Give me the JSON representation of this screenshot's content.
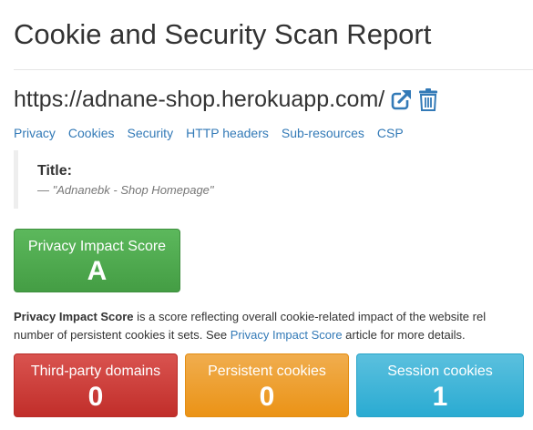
{
  "page": {
    "title": "Cookie and Security Scan Report"
  },
  "site": {
    "url": "https://adnane-shop.herokuapp.com/"
  },
  "icons": {
    "open": "external-link-icon",
    "delete": "trash-icon"
  },
  "colors": {
    "link": "#337ab7",
    "success": "#5cb85c",
    "danger": "#d9534f",
    "warning": "#f0ad4e",
    "info": "#5bc0de"
  },
  "nav": {
    "links": [
      "Privacy",
      "Cookies",
      "Security",
      "HTTP headers",
      "Sub-resources",
      "CSP"
    ]
  },
  "title_block": {
    "heading": "Title:",
    "value": "— \"Adnanebk - Shop Homepage\""
  },
  "privacy_score": {
    "label": "Privacy Impact Score",
    "grade": "A"
  },
  "explanation": {
    "term": "Privacy Impact Score",
    "text1": " is a score reflecting overall cookie-related impact of the website rel",
    "text2": "number of persistent cookies it sets. See ",
    "link": "Privacy Impact Score",
    "text3": " article for more details."
  },
  "stats": {
    "third_party": {
      "label": "Third-party domains",
      "value": "0"
    },
    "persistent": {
      "label": "Persistent cookies",
      "value": "0"
    },
    "session": {
      "label": "Session cookies",
      "value": "1"
    }
  }
}
